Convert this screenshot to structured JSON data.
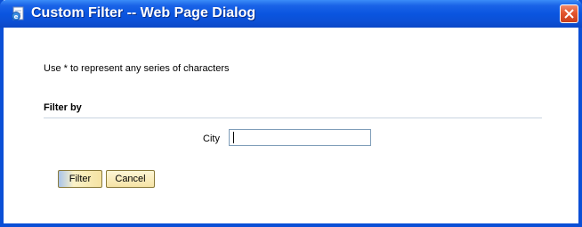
{
  "window": {
    "title": "Custom Filter -- Web Page Dialog",
    "title_icon": "ie-page-icon",
    "close_icon": "close-icon"
  },
  "dialog": {
    "instructions": "Use * to represent any series of characters",
    "section_title": "Filter by",
    "field": {
      "label": "City",
      "value": "",
      "placeholder": ""
    },
    "buttons": {
      "filter_label": "Filter",
      "cancel_label": "Cancel"
    }
  },
  "colors": {
    "titlebar": "#0a55e0",
    "close_button": "#e2552e",
    "button_face": "#f6e4a6"
  }
}
